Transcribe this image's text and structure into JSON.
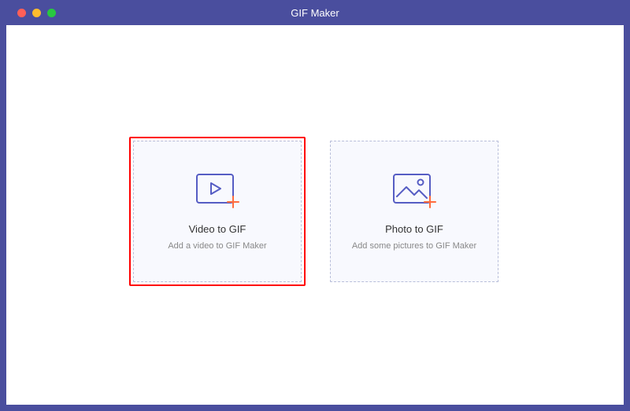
{
  "window": {
    "title": "GIF Maker"
  },
  "options": {
    "video": {
      "title": "Video to GIF",
      "subtitle": "Add a video to GIF Maker",
      "selected": true
    },
    "photo": {
      "title": "Photo to GIF",
      "subtitle": "Add some pictures to GIF Maker",
      "selected": false
    }
  },
  "colors": {
    "frame": "#4a4e9e",
    "highlight": "#ff0000",
    "iconStroke": "#565dc4",
    "plus": "#ff6b3d"
  }
}
